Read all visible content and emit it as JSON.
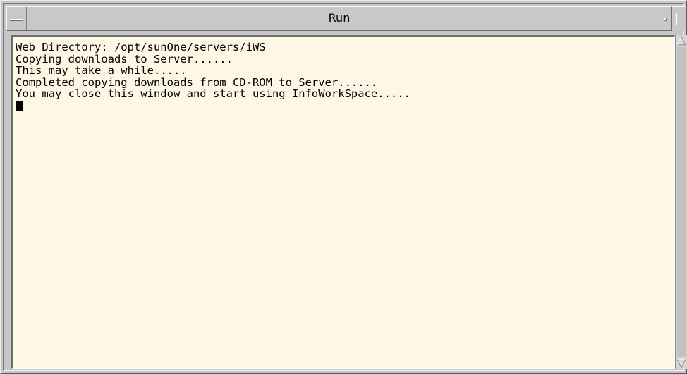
{
  "window": {
    "title": "Run"
  },
  "terminal": {
    "lines": [
      "Web Directory: /opt/sunOne/servers/iWS",
      "Copying downloads to Server......",
      "This may take a while.....",
      "Completed copying downloads from CD-ROM to Server......",
      "You may close this window and start using InfoWorkSpace....."
    ]
  },
  "colors": {
    "terminal_background": "#fff7e6",
    "window_chrome": "#c6c6c6",
    "text": "#000000"
  },
  "icons": {
    "window_menu": "window-menu-icon",
    "minimize": "minimize-icon",
    "maximize": "maximize-icon",
    "scroll_up": "scroll-up-arrow-icon",
    "scroll_down": "scroll-down-arrow-icon"
  }
}
